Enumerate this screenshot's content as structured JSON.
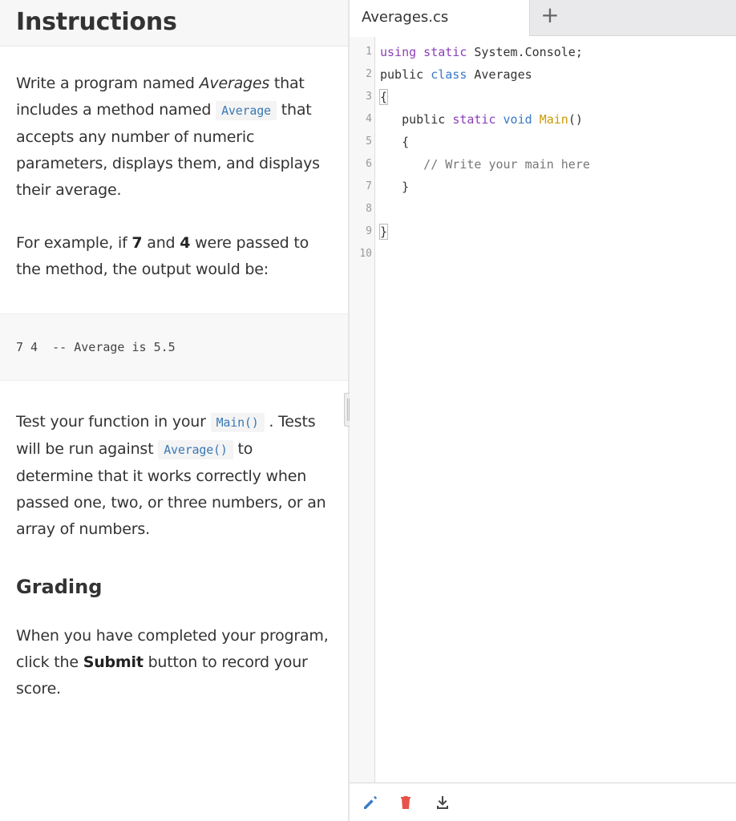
{
  "instructions": {
    "title": "Instructions",
    "p1": {
      "t1": "Write a program named ",
      "em1": "Averages",
      "t2": " that includes a method named ",
      "code1": "Average",
      "t3": " that accepts any number of numeric parameters, displays them, and displays their average."
    },
    "p2": {
      "t1": "For example, if ",
      "b1": "7",
      "t2": " and ",
      "b2": "4",
      "t3": " were passed to the method, the output would be:"
    },
    "example_output": "7 4  -- Average is 5.5",
    "p3": {
      "t1": "Test your function in your ",
      "code1": "Main()",
      "t2": " . Tests will be run against ",
      "code2": "Average()",
      "t3": " to determine that it works correctly when passed one, two, or three numbers, or an array of numbers."
    },
    "grading_heading": "Grading",
    "p4": {
      "t1": "When you have completed your program, click the ",
      "b1": "Submit",
      "t2": " button to record your score."
    }
  },
  "editor": {
    "tab_label": "Averages.cs",
    "add_tab_symbol": "+",
    "lines": [
      {
        "n": "1",
        "parts": [
          [
            "kw",
            "using static"
          ],
          [
            "",
            " System.Console;"
          ]
        ]
      },
      {
        "n": "2",
        "parts": [
          [
            "",
            "public "
          ],
          [
            "kw2",
            "class"
          ],
          [
            "",
            " Averages"
          ]
        ]
      },
      {
        "n": "3",
        "parts": [
          [
            "br",
            "{"
          ]
        ]
      },
      {
        "n": "4",
        "parts": [
          [
            "",
            "   public "
          ],
          [
            "kw",
            "static"
          ],
          [
            "",
            " "
          ],
          [
            "kw2",
            "void"
          ],
          [
            "",
            " "
          ],
          [
            "fn",
            "Main"
          ],
          [
            "",
            "()"
          ]
        ]
      },
      {
        "n": "5",
        "parts": [
          [
            "",
            "   {"
          ]
        ]
      },
      {
        "n": "6",
        "parts": [
          [
            "cm",
            "      // Write your main here"
          ]
        ]
      },
      {
        "n": "7",
        "parts": [
          [
            "",
            "   }"
          ]
        ]
      },
      {
        "n": "8",
        "parts": []
      },
      {
        "n": "9",
        "parts": [
          [
            "br",
            "}"
          ]
        ]
      },
      {
        "n": "10",
        "parts": []
      }
    ]
  },
  "toolbar": {
    "edit_icon": "pencil-icon",
    "delete_icon": "trash-icon",
    "download_icon": "download-icon",
    "colors": {
      "edit": "#3d7cc9",
      "delete": "#e5534b",
      "download": "#444444"
    }
  }
}
